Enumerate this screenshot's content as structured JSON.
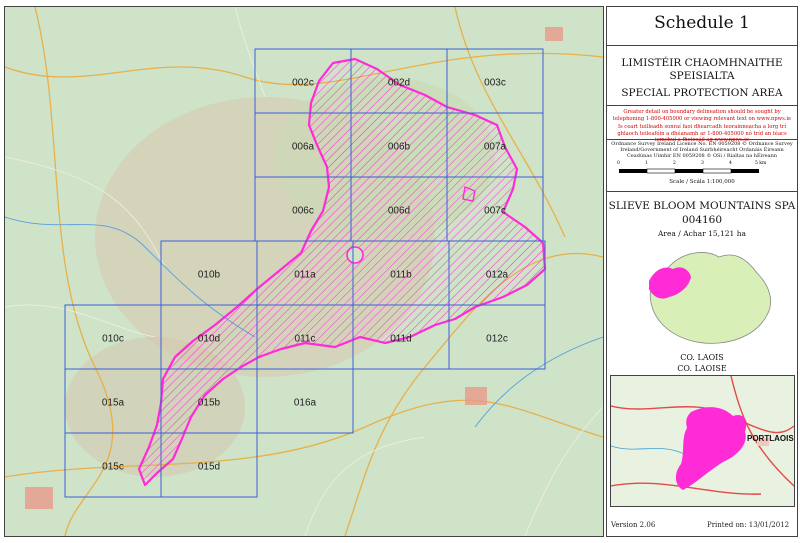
{
  "schedule_title": "Schedule 1",
  "header": {
    "irish_line1": "LIMISTÉIR CHAOMHNAITHE",
    "irish_line2": "SPEISIALTA",
    "english": "SPECIAL PROTECTION AREA"
  },
  "warning_text": {
    "english": "Greater detail on boundary delineation should be sought by telephoning 1-800-405000 or viewing relevant text on www.npws.ie",
    "irish": "Is ceart tuilleadh sonraí faoi dhearcadh teorainneacha a lorg trí ghlaoch teileafóin a dhéanamh ar 1-800-405000 nó tríd an téacs iomchuí a fheiceáil ag www.npws.ie"
  },
  "licence_text": "Ordnance Survey Ireland Licence No. EN 0059208 © Ordnance Survey Ireland/Government of Ireland Suirbhéireacht Ordanáis Éireann Ceadúnas Uimhir EN 0059208 © OSi / Rialtas na hÉireann",
  "scale": {
    "ticks": [
      "0",
      "1",
      "2",
      "3",
      "4",
      "5 km"
    ],
    "label": "Scale / Scála 1:100,000"
  },
  "spa": {
    "name": "SLIEVE BLOOM MOUNTAINS SPA",
    "code": "004160",
    "area": "Area / Achar 15,121 ha"
  },
  "county": {
    "english": "CO. LAOIS",
    "irish": "CO. LAOISE"
  },
  "inset_label": "PORTLAOISE",
  "version": "Version 2.06",
  "printed": "Printed on: 13/01/2012",
  "colors": {
    "spa_fill": "#ff2bd6",
    "tile_grid": "#3a5fd8",
    "warning": "#d10000",
    "map_background": "#cfe3c8",
    "county_fill": "#d9efb8"
  },
  "tiles": [
    {
      "label": "002c"
    },
    {
      "label": "002d"
    },
    {
      "label": "003c"
    },
    {
      "label": "006a"
    },
    {
      "label": "006b"
    },
    {
      "label": "007a"
    },
    {
      "label": "006c"
    },
    {
      "label": "006d"
    },
    {
      "label": "007c"
    },
    {
      "label": "010b"
    },
    {
      "label": "011a"
    },
    {
      "label": "011b"
    },
    {
      "label": "012a"
    },
    {
      "label": "010c"
    },
    {
      "label": "010d"
    },
    {
      "label": "011c"
    },
    {
      "label": "011d"
    },
    {
      "label": "012c"
    },
    {
      "label": "015a"
    },
    {
      "label": "015b"
    },
    {
      "label": "016a"
    },
    {
      "label": "015c"
    },
    {
      "label": "015d"
    }
  ]
}
